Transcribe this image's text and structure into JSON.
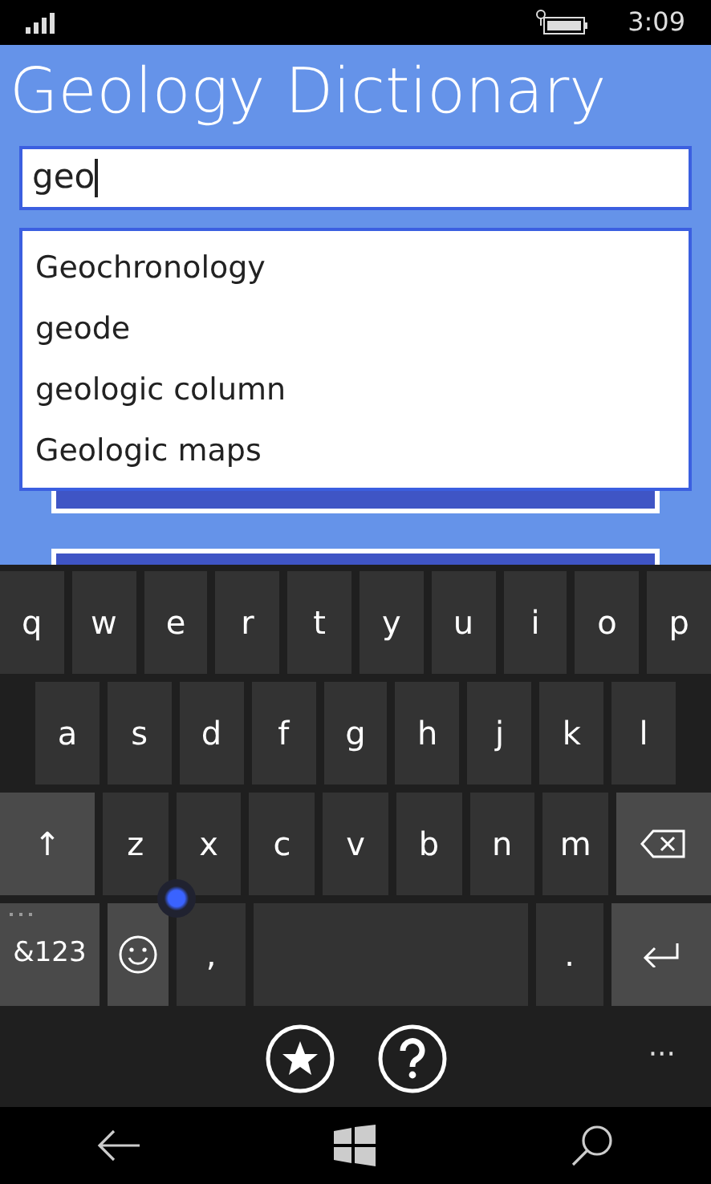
{
  "status_bar": {
    "time": "3:09"
  },
  "app": {
    "title": "Geology Dictionary"
  },
  "search": {
    "value": "geo"
  },
  "suggestions": [
    {
      "label": "Geochronology"
    },
    {
      "label": "geode"
    },
    {
      "label": "geologic column"
    },
    {
      "label": "Geologic maps"
    }
  ],
  "keyboard": {
    "rows": [
      {
        "keys": [
          {
            "kind": "char",
            "label": "q"
          },
          {
            "kind": "char",
            "label": "w"
          },
          {
            "kind": "char",
            "label": "e"
          },
          {
            "kind": "char",
            "label": "r"
          },
          {
            "kind": "char",
            "label": "t"
          },
          {
            "kind": "char",
            "label": "y"
          },
          {
            "kind": "char",
            "label": "u"
          },
          {
            "kind": "char",
            "label": "i"
          },
          {
            "kind": "char",
            "label": "o"
          },
          {
            "kind": "char",
            "label": "p"
          }
        ]
      },
      {
        "keys": [
          {
            "kind": "char",
            "label": "a"
          },
          {
            "kind": "char",
            "label": "s"
          },
          {
            "kind": "char",
            "label": "d"
          },
          {
            "kind": "char",
            "label": "f"
          },
          {
            "kind": "char",
            "label": "g"
          },
          {
            "kind": "char",
            "label": "h"
          },
          {
            "kind": "char",
            "label": "j"
          },
          {
            "kind": "char",
            "label": "k"
          },
          {
            "kind": "char",
            "label": "l"
          }
        ]
      },
      {
        "keys": [
          {
            "kind": "shift",
            "label": "↑"
          },
          {
            "kind": "char",
            "label": "z"
          },
          {
            "kind": "char",
            "label": "x"
          },
          {
            "kind": "char",
            "label": "c"
          },
          {
            "kind": "char",
            "label": "v"
          },
          {
            "kind": "char",
            "label": "b"
          },
          {
            "kind": "char",
            "label": "n"
          },
          {
            "kind": "char",
            "label": "m"
          },
          {
            "kind": "backspace"
          }
        ]
      },
      {
        "keys": [
          {
            "kind": "symbols",
            "label": "&123"
          },
          {
            "kind": "emoji"
          },
          {
            "kind": "char",
            "label": ","
          },
          {
            "kind": "space"
          },
          {
            "kind": "char",
            "label": "."
          },
          {
            "kind": "enter"
          }
        ]
      }
    ]
  },
  "app_bar": {
    "more": "···"
  }
}
